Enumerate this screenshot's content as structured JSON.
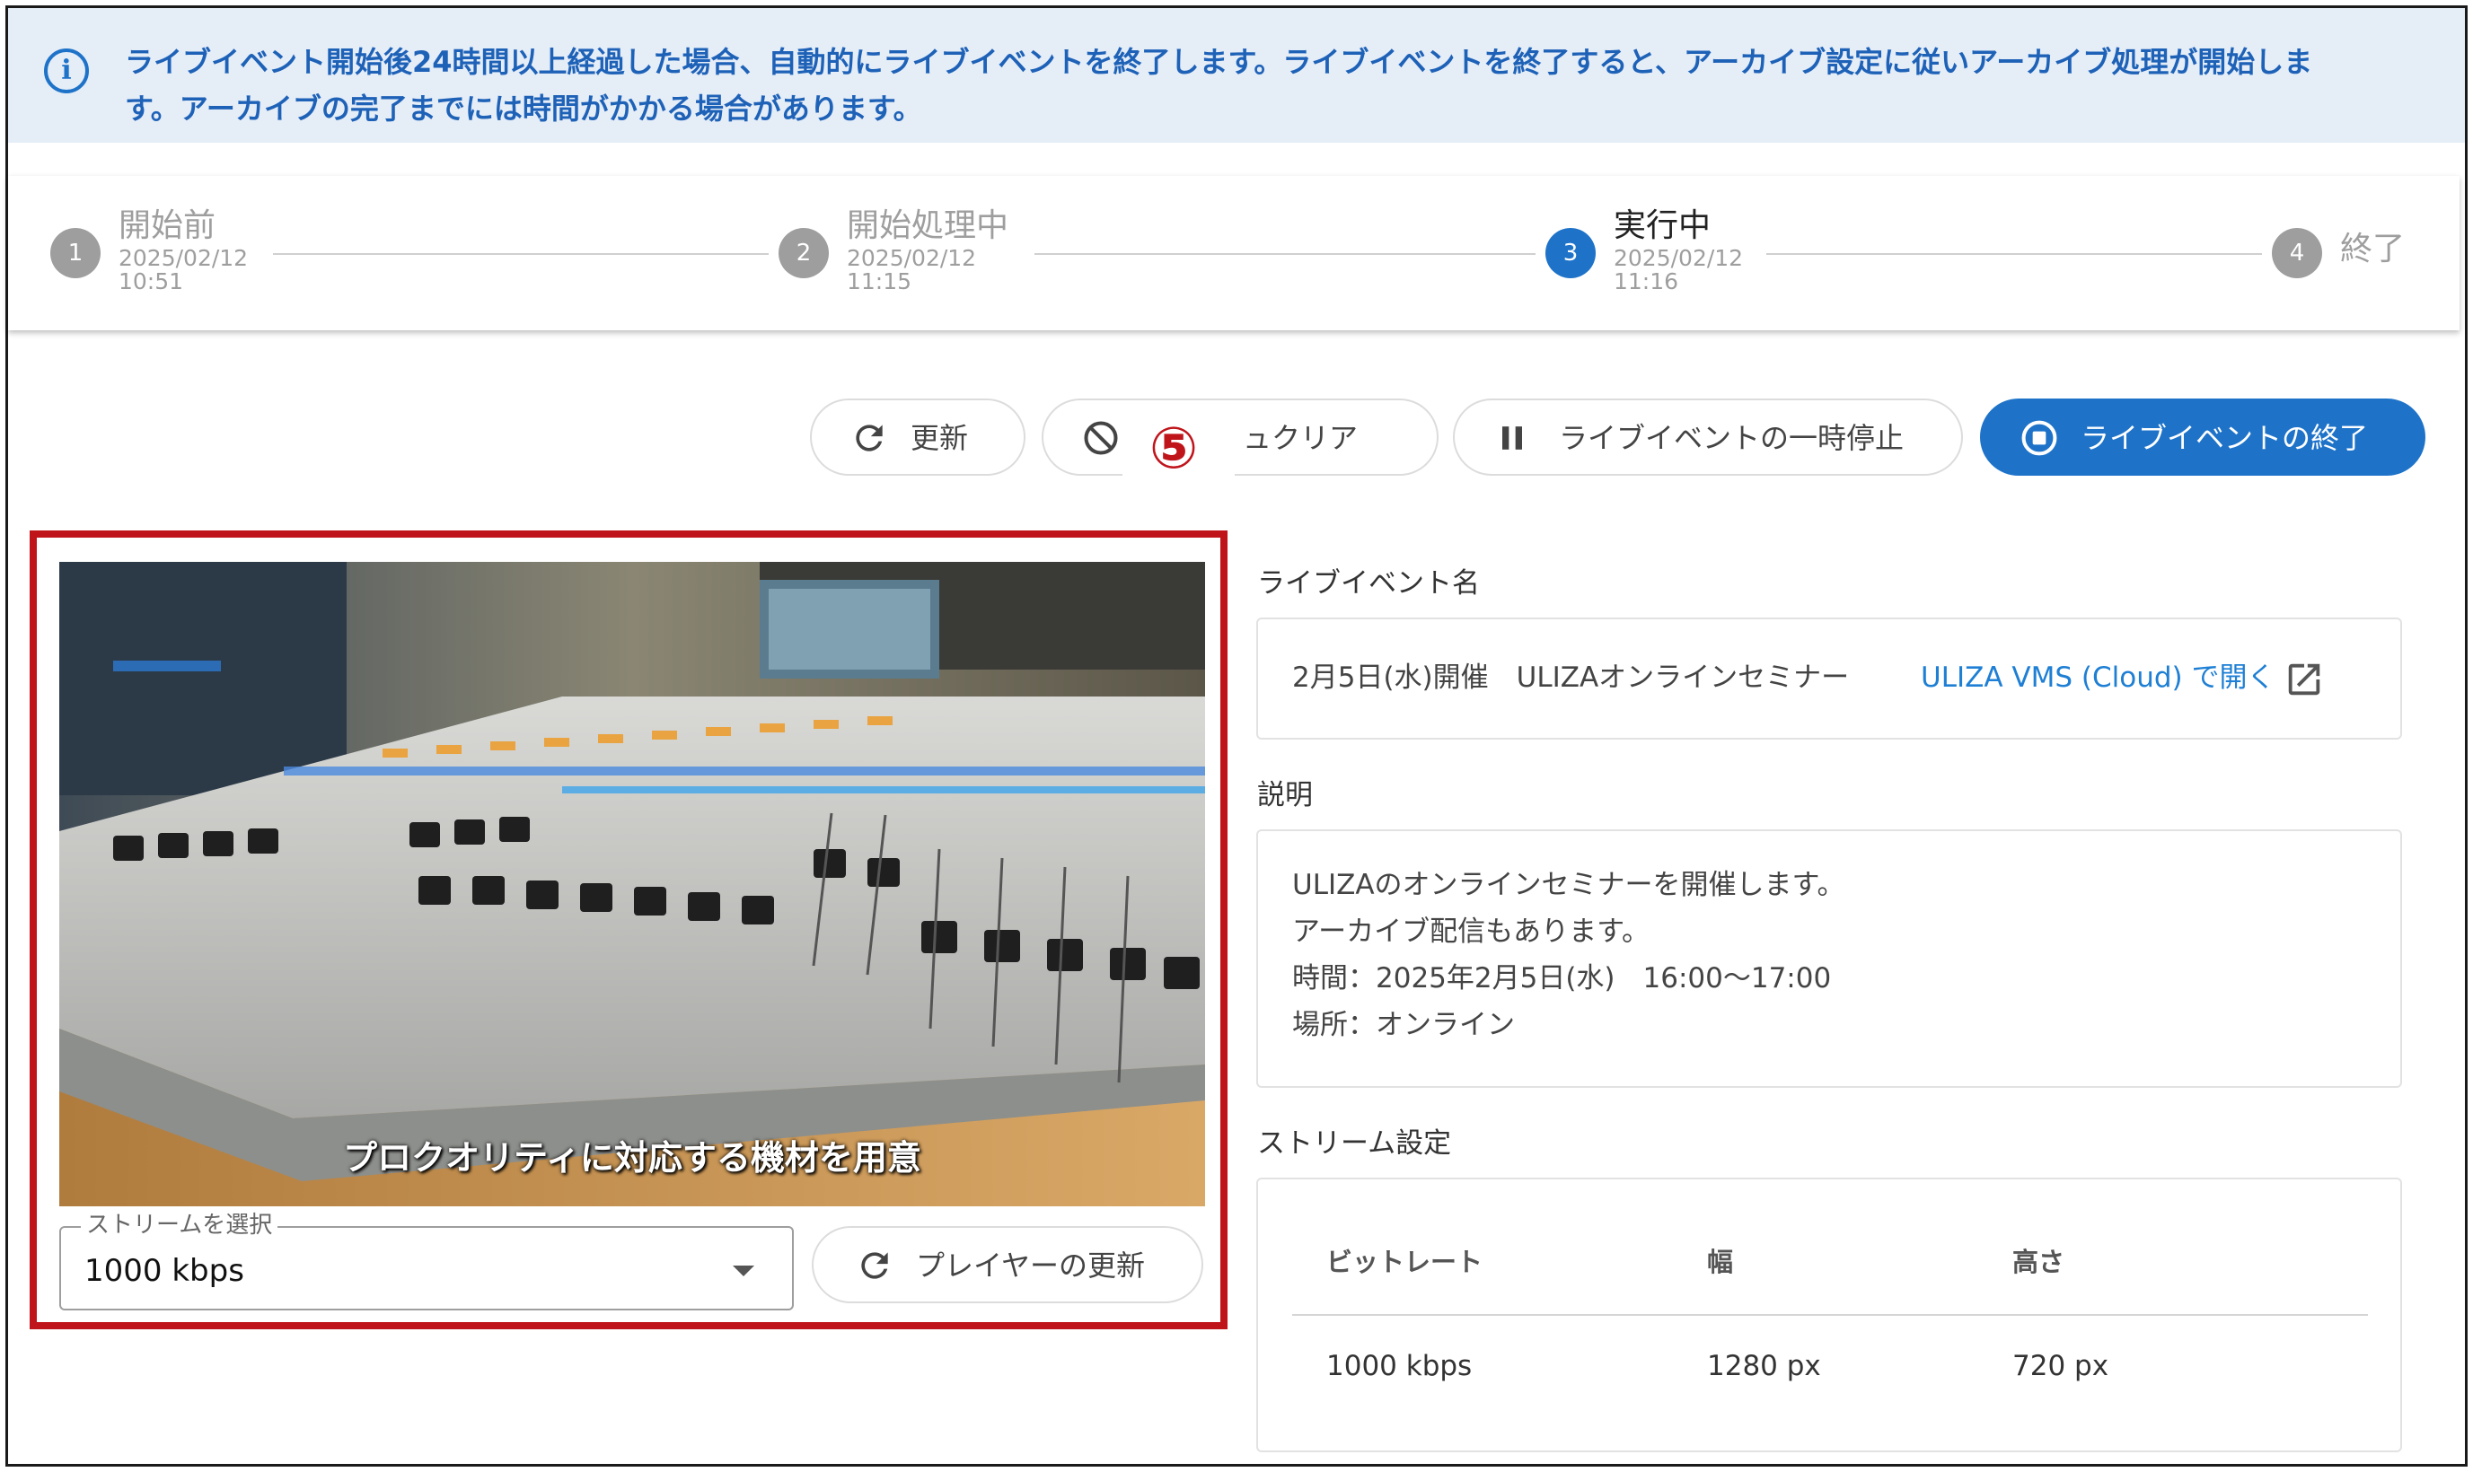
{
  "banner": {
    "icon": "info-icon",
    "line1": "ライブイベント開始後24時間以上経過した場合、自動的にライブイベントを終了します。ライブイベントを終了すると、アーカイブ設定に従いアーカイブ処理が開始しま",
    "line2": "す。アーカイブの完了までには時間がかかる場合があります。"
  },
  "stepper": {
    "steps": [
      {
        "num": "1",
        "label": "開始前",
        "date": "2025/02/12",
        "time": "10:51",
        "active": false
      },
      {
        "num": "2",
        "label": "開始処理中",
        "date": "2025/02/12",
        "time": "11:15",
        "active": false
      },
      {
        "num": "3",
        "label": "実行中",
        "date": "2025/02/12",
        "time": "11:16",
        "active": true
      },
      {
        "num": "4",
        "label": "終了",
        "date": "",
        "time": "",
        "active": false
      }
    ]
  },
  "toolbar": {
    "refresh_label": "更新",
    "cache_clear_label": "ュクリア",
    "pause_label": "ライブイベントの一時停止",
    "end_label": "ライブイベントの終了",
    "annotation_marker": "⑤"
  },
  "player": {
    "caption": "プロクオリティに対応する機材を用意",
    "stream_select_legend": "ストリームを選択",
    "stream_select_value": "1000 kbps",
    "reload_label": "プレイヤーの更新"
  },
  "event": {
    "name_title": "ライブイベント名",
    "name": "2月5日(水)開催　ULIZAオンラインセミナー",
    "link_label": "ULIZA VMS (Cloud) で開く",
    "desc_title": "説明",
    "desc_lines": [
      "ULIZAのオンラインセミナーを開催します。",
      "アーカイブ配信もあります。",
      "時間：2025年2月5日(水)　16:00〜17:00",
      "場所：オンライン"
    ],
    "stream_title": "ストリーム設定",
    "table": {
      "headers": [
        "ビットレート",
        "幅",
        "高さ"
      ],
      "rows": [
        [
          "1000 kbps",
          "1280 px",
          "720 px"
        ]
      ]
    }
  },
  "colors": {
    "accent": "#1e73c9",
    "annotation": "#c0141b",
    "banner_bg": "#e5edf7",
    "link": "#1e7fd4"
  }
}
